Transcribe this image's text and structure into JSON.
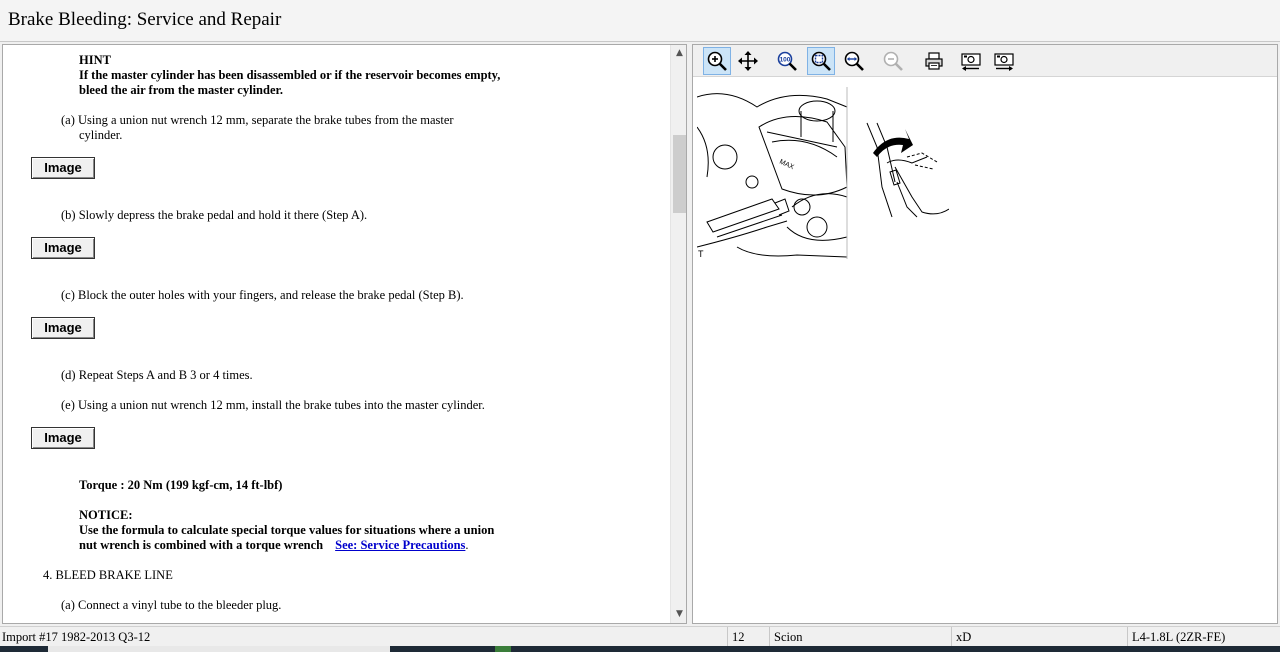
{
  "window": {
    "title": "Brake Bleeding:  Service and Repair"
  },
  "document": {
    "hint_title": "HINT",
    "hint_line1": "If the master cylinder has been disassembled or if the reservoir becomes empty,",
    "hint_line2": "bleed the air from the master cylinder.",
    "step_a_line1": "(a) Using a union nut wrench 12 mm, separate the brake tubes from the master",
    "step_a_line2": "cylinder.",
    "image_button_label": "Image",
    "step_b": "(b) Slowly depress the brake pedal and hold it there (Step A).",
    "step_c": "(c) Block the outer holes with your fingers, and release the brake pedal (Step B).",
    "step_d": "(d) Repeat Steps A and B 3 or 4 times.",
    "step_e": "(e) Using a union nut wrench 12 mm, install the brake tubes into the master cylinder.",
    "torque": "Torque : 20 Nm (199 kgf-cm, 14 ft-lbf)",
    "notice_title": "NOTICE:",
    "notice_line1": "Use the formula to calculate special torque values for situations where a union",
    "notice_line2": "nut wrench is combined with a torque wrench",
    "notice_link": "See: Service Precautions",
    "notice_end": ".",
    "section4": "4.  BLEED BRAKE LINE",
    "step_4a": "(a) Connect a vinyl tube to the bleeder plug."
  },
  "scrollbar": {
    "up_arrow": "▲",
    "down_arrow": "▼"
  },
  "figure": {
    "corner_label": "T",
    "max_label": "MAX"
  },
  "toolbar": {
    "buttons": [
      {
        "icon": "zoom-in-icon",
        "active": true
      },
      {
        "icon": "pan-move-icon",
        "active": false
      },
      {
        "icon": "zoom-100-icon",
        "label": "100%",
        "active": false
      },
      {
        "icon": "zoom-fit-icon",
        "active": true
      },
      {
        "icon": "zoom-width-icon",
        "active": false
      },
      {
        "icon": "zoom-out-icon",
        "active": false,
        "disabled": true
      },
      {
        "icon": "print-icon",
        "active": false
      },
      {
        "icon": "previous-image-icon",
        "active": false
      },
      {
        "icon": "next-image-icon",
        "active": false
      }
    ]
  },
  "status": {
    "source": "Import #17 1982-2013 Q3-12",
    "year": "12",
    "make": "Scion",
    "model": "xD",
    "engine": "L4-1.8L (2ZR-FE)"
  },
  "colors": {
    "link": "#0000cc",
    "active_tool": "#cce4f7",
    "taskbar": "#1e2a36"
  }
}
